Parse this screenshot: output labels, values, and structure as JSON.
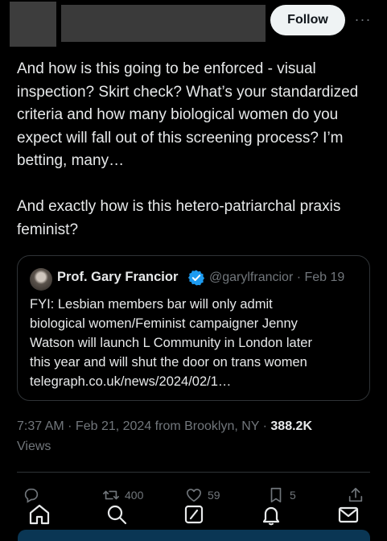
{
  "header": {
    "follow_label": "Follow",
    "more_label": "···"
  },
  "tweet": {
    "paragraphs": [
      "And how is this going to be enforced - visual inspection? Skirt check? What’s your standardized criteria and how many biological women do you expect will fall out of this screening process? I’m betting, many…",
      "And exactly how is this hetero-patriarchal praxis feminist?"
    ]
  },
  "quote": {
    "author_name": "Prof. Gary Francior",
    "handle_date": "@garylfrancior · Feb 19",
    "lines": [
      "FYI: Lesbian members bar will only admit",
      "biological women/Feminist campaigner Jenny",
      "Watson will launch L Community in London later",
      "this year and will shut the door on trans women",
      "telegraph.co.uk/news/2024/02/1…"
    ],
    "verified_color": "#1d9bf0"
  },
  "meta": {
    "timestamp": "7:37 AM · Feb 21, 2024 from Brooklyn, NY · ",
    "views_count": "388.2K",
    "views_label": "Views"
  },
  "actions": {
    "reposts": "400",
    "likes": "59",
    "bookmarks": "5"
  },
  "colors": {
    "background": "#000000",
    "text": "#e7e9ea",
    "muted": "#71767b",
    "accent": "#1d9bf0"
  }
}
